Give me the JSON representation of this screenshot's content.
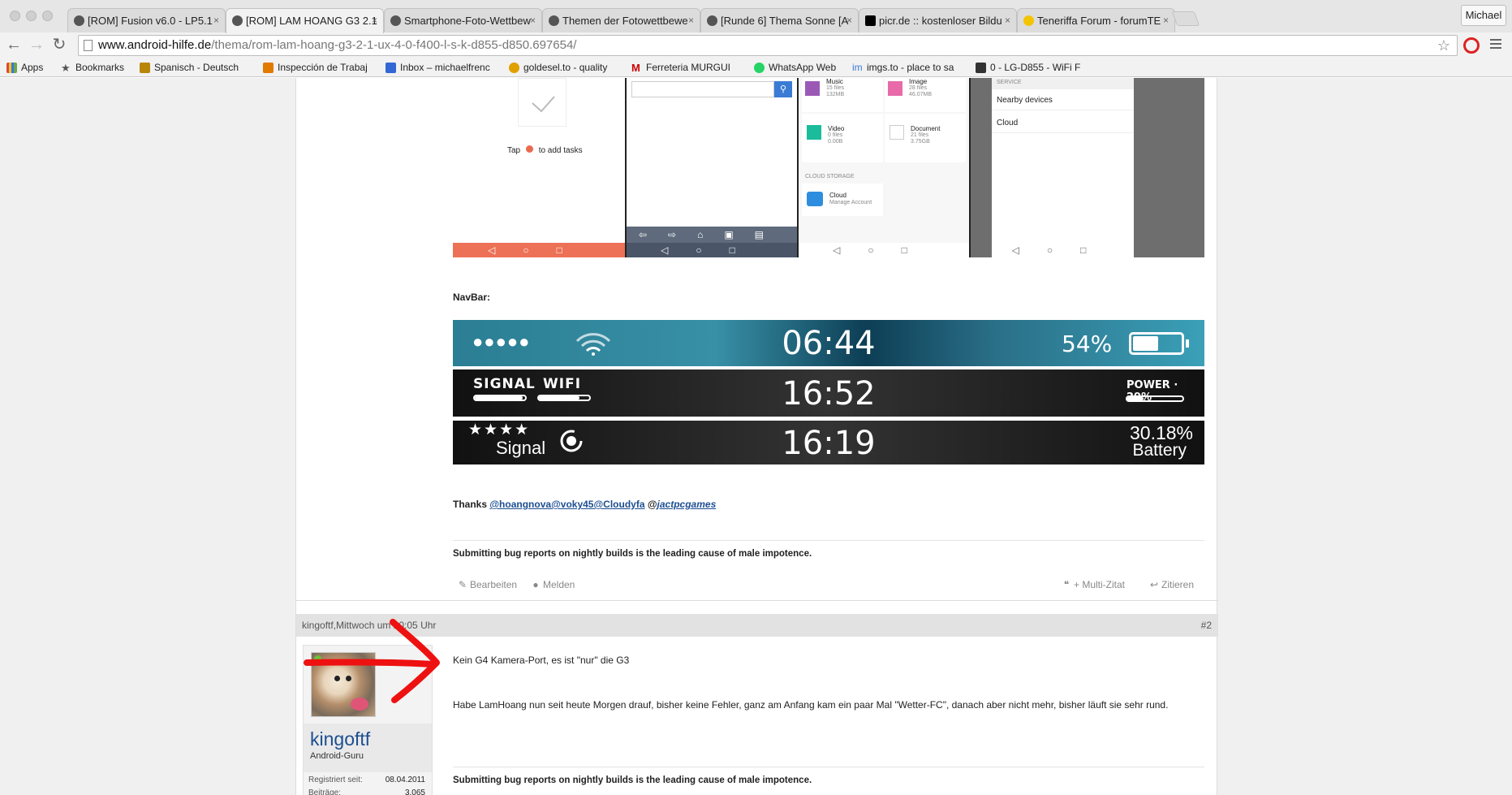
{
  "browser": {
    "tabs": [
      {
        "title": "[ROM] Fusion v6.0 - LP5.1"
      },
      {
        "title": "[ROM] LAM HOANG G3 2.1"
      },
      {
        "title": "Smartphone-Foto-Wettbew"
      },
      {
        "title": "Themen der Fotowettbewe"
      },
      {
        "title": "[Runde 6] Thema Sonne [A"
      },
      {
        "title": "picr.de :: kostenloser Bildu"
      },
      {
        "title": "Teneriffa Forum - forumTE"
      }
    ],
    "close_glyph": "×",
    "user": "Michael",
    "url_host": "www.android-hilfe.de",
    "url_path": "/thema/rom-lam-hoang-g3-2-1-ux-4-0-f400-l-s-k-d855-d850.697654/",
    "bookmarks": [
      {
        "label": "Apps",
        "color": "#d94a38"
      },
      {
        "label": "Bookmarks",
        "color": "#666666"
      },
      {
        "label": "Spanisch - Deutsch",
        "color": "#b8860b"
      },
      {
        "label": "Inspección de Trabaj",
        "color": "#e07b00"
      },
      {
        "label": "Inbox – michaelfrenc",
        "color": "#3367d6"
      },
      {
        "label": "goldesel.to - quality",
        "color": "#e0a000"
      },
      {
        "label": "Ferreteria MURGUI",
        "color": "#cc0000"
      },
      {
        "label": "WhatsApp Web",
        "color": "#25d366"
      },
      {
        "label": "imgs.to - place to sa",
        "color": "#3a7bd5"
      },
      {
        "label": "0 - LG-D855 - WiFi F",
        "color": "#333333"
      }
    ]
  },
  "screens": {
    "todo_tap": "Tap",
    "todo_add": "to add tasks",
    "files": [
      {
        "name": "Music",
        "count": "15 files",
        "size": "132MB"
      },
      {
        "name": "Image",
        "count": "28 files",
        "size": "46.07MB"
      },
      {
        "name": "Video",
        "count": "0 files",
        "size": "0.00B"
      },
      {
        "name": "Document",
        "count": "21 files",
        "size": "3.75GB"
      }
    ],
    "cloud_storage": "CLOUD STORAGE",
    "cloud": "Cloud",
    "cloud_manage": "Manage Account",
    "service": "SERVICE",
    "nearby": "Nearby devices",
    "service_cloud": "Cloud"
  },
  "post": {
    "navbar_label": "NavBar:",
    "bar1": {
      "dots": "●●●●●",
      "time": "06:44",
      "battery": "54%",
      "battery_level": 0.54
    },
    "bar2": {
      "signal": "SIGNAL",
      "wifi": "WIFI",
      "time": "16:52",
      "power": "POWER · 29%",
      "signal_level": 0.95,
      "wifi_level": 0.8,
      "power_level": 0.29
    },
    "bar3": {
      "stars": "★★★★",
      "signal": "Signal",
      "time": "16:19",
      "battery_value": "30.18%",
      "battery": "Battery"
    },
    "thanks_label": "Thanks",
    "thanks_mentions": "@hoangnova@voky45@Cloudyfa",
    "thanks_at": "@",
    "thanks_last": "jactpcgames",
    "signature": "Submitting bug reports on nightly builds is the leading cause of male impotence.",
    "edit": "Bearbeiten",
    "report": "Melden",
    "multiquote": "+ Multi-Zitat",
    "quote": "Zitieren"
  },
  "reply": {
    "header": "kingoftf,Mittwoch um 20:05 Uhr",
    "number": "#2",
    "username": "kingoftf",
    "rank": "Android-Guru",
    "registered_label": "Registriert seit:",
    "registered": "08.04.2011",
    "posts_label": "Beiträge:",
    "posts": "3.065",
    "text1": "Kein G4 Kamera-Port, es ist \"nur\" die G3",
    "text2": "Habe LamHoang nun seit heute Morgen drauf, bisher keine Fehler, ganz am Anfang kam ein paar Mal \"Wetter-FC\", danach aber nicht mehr, bisher läuft sie sehr rund.",
    "signature": "Submitting bug reports on nightly builds is the leading cause of male impotence."
  }
}
